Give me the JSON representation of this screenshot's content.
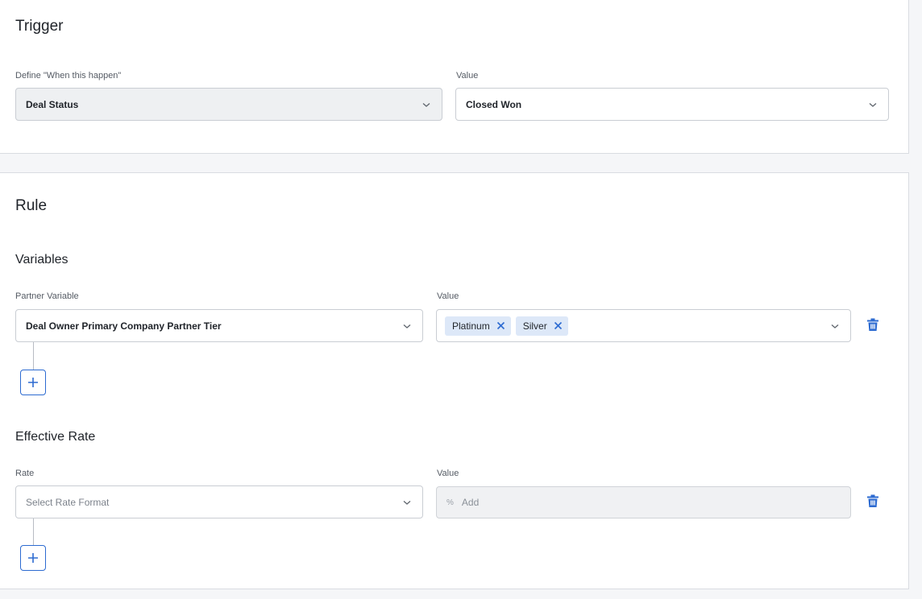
{
  "trigger": {
    "title": "Trigger",
    "define_label": "Define \"When this happen\"",
    "define_value": "Deal Status",
    "value_label": "Value",
    "value_value": "Closed Won"
  },
  "rule": {
    "title": "Rule",
    "variables": {
      "title": "Variables",
      "partner_variable_label": "Partner Variable",
      "partner_variable_value": "Deal Owner Primary Company Partner Tier",
      "value_label": "Value",
      "chips": [
        "Platinum",
        "Silver"
      ]
    },
    "effective_rate": {
      "title": "Effective Rate",
      "rate_label": "Rate",
      "rate_placeholder": "Select Rate Format",
      "value_label": "Value",
      "value_prefix": "%",
      "value_placeholder": "Add"
    }
  },
  "colors": {
    "accent": "#2d6bd1",
    "chip_bg": "#dde8f8",
    "disabled_bg": "#eef0f2"
  },
  "icons": [
    "chevron-down-icon",
    "close-icon",
    "trash-icon",
    "plus-icon"
  ]
}
